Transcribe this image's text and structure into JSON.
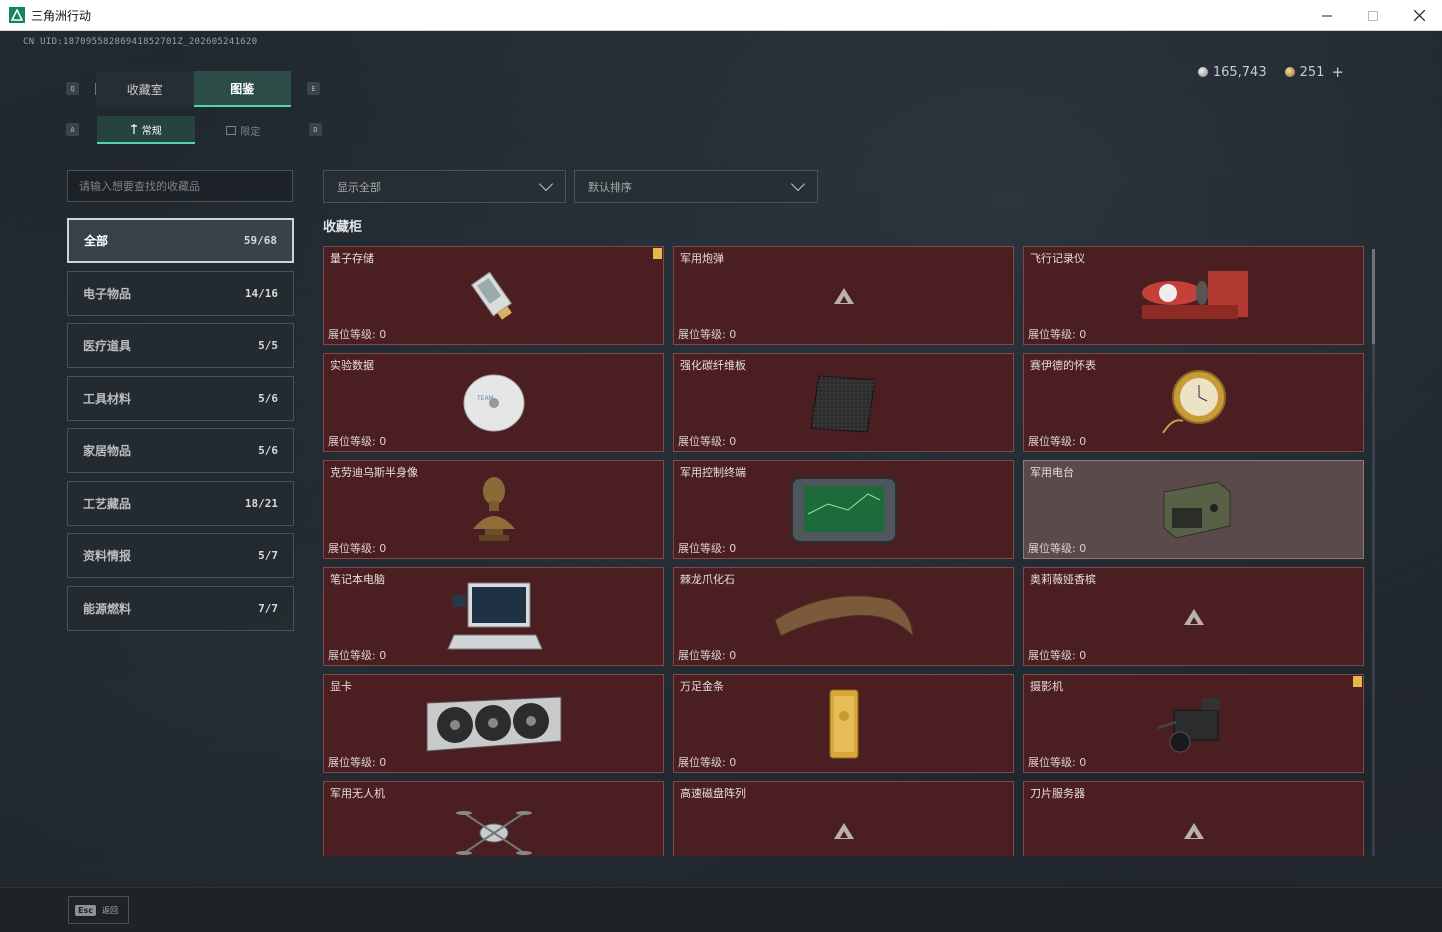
{
  "window": {
    "title": "三角洲行动"
  },
  "header": {
    "uid": "CN UID:18709558286941852701Z_202605241620",
    "currency": {
      "silver": "165,743",
      "gold": "251",
      "add": "+"
    }
  },
  "keys": {
    "tab_left": "Q",
    "tab_right": "E",
    "sub_left": "A",
    "sub_right": "D"
  },
  "tabs": [
    {
      "label": "收藏室",
      "active": false
    },
    {
      "label": "图鉴",
      "active": true
    }
  ],
  "subtabs": [
    {
      "label": "常规",
      "active": true
    },
    {
      "label": "限定",
      "active": false
    }
  ],
  "search": {
    "placeholder": "请输入想要查找的收藏品"
  },
  "categories": [
    {
      "label": "全部",
      "count": "59/68",
      "active": true
    },
    {
      "label": "电子物品",
      "count": "14/16"
    },
    {
      "label": "医疗道具",
      "count": "5/5"
    },
    {
      "label": "工具材料",
      "count": "5/6"
    },
    {
      "label": "家居物品",
      "count": "5/6"
    },
    {
      "label": "工艺藏品",
      "count": "18/21"
    },
    {
      "label": "资料情报",
      "count": "5/7"
    },
    {
      "label": "能源燃料",
      "count": "7/7"
    }
  ],
  "filters": {
    "show": "显示全部",
    "sort": "默认排序"
  },
  "section": {
    "title": "收藏柜"
  },
  "level_label": "展位等级: ",
  "items": [
    {
      "name": "量子存储",
      "level": "0",
      "icon": "usb-drive-icon",
      "alert": true
    },
    {
      "name": "军用炮弹",
      "level": "0",
      "icon": "locked-icon"
    },
    {
      "name": "飞行记录仪",
      "level": "0",
      "icon": "flight-recorder-icon"
    },
    {
      "name": "实验数据",
      "level": "0",
      "icon": "disc-icon"
    },
    {
      "name": "强化碳纤维板",
      "level": "0",
      "icon": "carbon-plate-icon"
    },
    {
      "name": "赛伊德的怀表",
      "level": "0",
      "icon": "pocket-watch-icon"
    },
    {
      "name": "克劳迪乌斯半身像",
      "level": "0",
      "icon": "bust-icon"
    },
    {
      "name": "军用控制终端",
      "level": "0",
      "icon": "terminal-icon"
    },
    {
      "name": "军用电台",
      "level": "0",
      "icon": "radio-icon",
      "grey": true
    },
    {
      "name": "笔记本电脑",
      "level": "0",
      "icon": "laptop-icon"
    },
    {
      "name": "棘龙爪化石",
      "level": "0",
      "icon": "claw-fossil-icon"
    },
    {
      "name": "奥莉薇娅香槟",
      "level": "0",
      "icon": "locked-icon"
    },
    {
      "name": "显卡",
      "level": "0",
      "icon": "graphics-card-icon"
    },
    {
      "name": "万足金条",
      "level": "0",
      "icon": "gold-bar-icon"
    },
    {
      "name": "摄影机",
      "level": "0",
      "icon": "camera-icon",
      "alert": true
    },
    {
      "name": "军用无人机",
      "level": "",
      "icon": "drone-icon"
    },
    {
      "name": "高速磁盘阵列",
      "level": "",
      "icon": "locked-icon"
    },
    {
      "name": "刀片服务器",
      "level": "",
      "icon": "locked-icon"
    }
  ],
  "footer": {
    "esc_key": "Esc",
    "esc_label": "返回"
  }
}
